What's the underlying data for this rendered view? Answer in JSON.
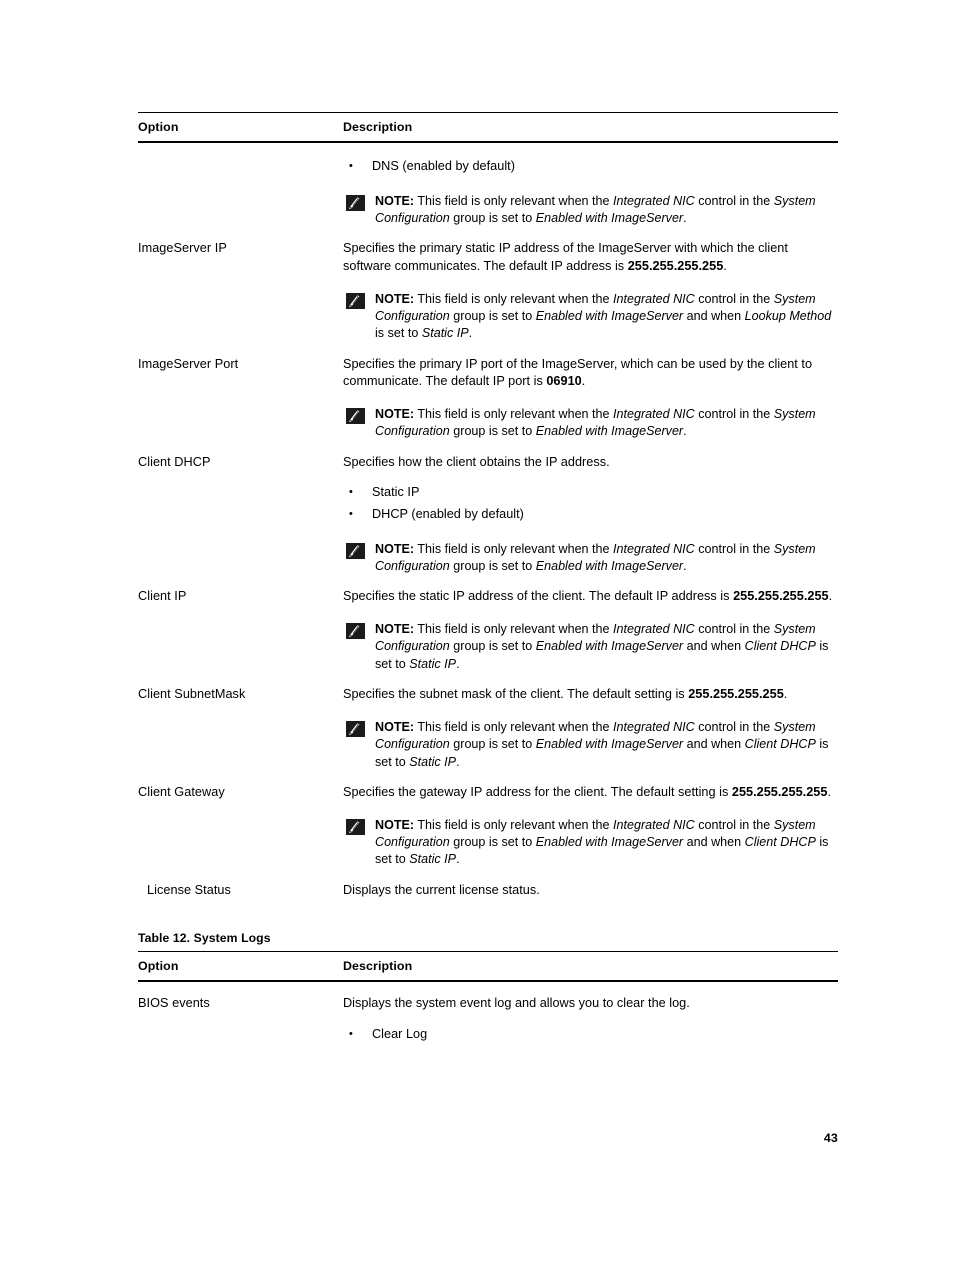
{
  "page": {
    "number": "43"
  },
  "tables": [
    {
      "caption": null,
      "headers": {
        "option": "Option",
        "description": "Description"
      },
      "rows": [
        {
          "option": "",
          "description_paragraph": null,
          "bullets": [
            "DNS (enabled by default)"
          ],
          "note": {
            "label": "NOTE:",
            "segments": [
              {
                "text": " This field is only relevant when the ",
                "style": "normal"
              },
              {
                "text": "Integrated NIC",
                "style": "italic"
              },
              {
                "text": " control in the ",
                "style": "normal"
              },
              {
                "text": "System Configuration",
                "style": "italic"
              },
              {
                "text": " group is set to ",
                "style": "normal"
              },
              {
                "text": "Enabled with ImageServer",
                "style": "italic"
              },
              {
                "text": ".",
                "style": "normal"
              }
            ]
          }
        },
        {
          "option": "ImageServer IP",
          "description_paragraph": [
            {
              "text": "Specifies the primary static IP address of the ImageServer with which the client software communicates. The default IP address is ",
              "style": "normal"
            },
            {
              "text": "255.255.255.255",
              "style": "bold"
            },
            {
              "text": ".",
              "style": "normal"
            }
          ],
          "bullets": [],
          "note": {
            "label": "NOTE:",
            "segments": [
              {
                "text": " This field is only relevant when the ",
                "style": "normal"
              },
              {
                "text": "Integrated NIC",
                "style": "italic"
              },
              {
                "text": " control in the ",
                "style": "normal"
              },
              {
                "text": "System Configuration",
                "style": "italic"
              },
              {
                "text": " group is set to ",
                "style": "normal"
              },
              {
                "text": "Enabled with ImageServer",
                "style": "italic"
              },
              {
                "text": " and when ",
                "style": "normal"
              },
              {
                "text": "Lookup Method",
                "style": "italic"
              },
              {
                "text": " is set to ",
                "style": "normal"
              },
              {
                "text": "Static IP",
                "style": "italic"
              },
              {
                "text": ".",
                "style": "normal"
              }
            ]
          }
        },
        {
          "option": "ImageServer Port",
          "description_paragraph": [
            {
              "text": "Specifies the primary IP port of the ImageServer, which can be used by the client to communicate. The default IP port is ",
              "style": "normal"
            },
            {
              "text": "06910",
              "style": "bold"
            },
            {
              "text": ".",
              "style": "normal"
            }
          ],
          "bullets": [],
          "note": {
            "label": "NOTE:",
            "segments": [
              {
                "text": " This field is only relevant when the ",
                "style": "normal"
              },
              {
                "text": "Integrated NIC",
                "style": "italic"
              },
              {
                "text": " control in the ",
                "style": "normal"
              },
              {
                "text": "System Configuration",
                "style": "italic"
              },
              {
                "text": " group is set to ",
                "style": "normal"
              },
              {
                "text": "Enabled with ImageServer",
                "style": "italic"
              },
              {
                "text": ".",
                "style": "normal"
              }
            ]
          }
        },
        {
          "option": "Client DHCP",
          "description_paragraph": [
            {
              "text": "Specifies how the client obtains the IP address.",
              "style": "normal"
            }
          ],
          "bullets": [
            "Static IP",
            "DHCP (enabled by default)"
          ],
          "note": {
            "label": "NOTE:",
            "segments": [
              {
                "text": " This field is only relevant when the ",
                "style": "normal"
              },
              {
                "text": "Integrated NIC",
                "style": "italic"
              },
              {
                "text": " control in the ",
                "style": "normal"
              },
              {
                "text": "System Configuration",
                "style": "italic"
              },
              {
                "text": " group is set to ",
                "style": "normal"
              },
              {
                "text": "Enabled with ImageServer",
                "style": "italic"
              },
              {
                "text": ".",
                "style": "normal"
              }
            ]
          }
        },
        {
          "option": "Client IP",
          "description_paragraph": [
            {
              "text": "Specifies the static IP address of the client. The default IP address is ",
              "style": "normal"
            },
            {
              "text": "255.255.255.255",
              "style": "bold"
            },
            {
              "text": ".",
              "style": "normal"
            }
          ],
          "bullets": [],
          "note": {
            "label": "NOTE:",
            "segments": [
              {
                "text": " This field is only relevant when the ",
                "style": "normal"
              },
              {
                "text": "Integrated NIC",
                "style": "italic"
              },
              {
                "text": " control in the ",
                "style": "normal"
              },
              {
                "text": "System Configuration",
                "style": "italic"
              },
              {
                "text": " group is set to ",
                "style": "normal"
              },
              {
                "text": "Enabled with ImageServer",
                "style": "italic"
              },
              {
                "text": " and when ",
                "style": "normal"
              },
              {
                "text": "Client DHCP",
                "style": "italic"
              },
              {
                "text": " is set to ",
                "style": "normal"
              },
              {
                "text": "Static IP",
                "style": "italic"
              },
              {
                "text": ".",
                "style": "normal"
              }
            ]
          }
        },
        {
          "option": "Client SubnetMask",
          "description_paragraph": [
            {
              "text": "Specifies the subnet mask of the client. The default setting is ",
              "style": "normal"
            },
            {
              "text": "255.255.255.255",
              "style": "bold"
            },
            {
              "text": ".",
              "style": "normal"
            }
          ],
          "bullets": [],
          "note": {
            "label": "NOTE:",
            "segments": [
              {
                "text": " This field is only relevant when the ",
                "style": "normal"
              },
              {
                "text": "Integrated NIC",
                "style": "italic"
              },
              {
                "text": " control in the ",
                "style": "normal"
              },
              {
                "text": "System Configuration",
                "style": "italic"
              },
              {
                "text": " group is set to ",
                "style": "normal"
              },
              {
                "text": "Enabled with ImageServer",
                "style": "italic"
              },
              {
                "text": " and when ",
                "style": "normal"
              },
              {
                "text": "Client DHCP",
                "style": "italic"
              },
              {
                "text": " is set to ",
                "style": "normal"
              },
              {
                "text": "Static IP",
                "style": "italic"
              },
              {
                "text": ".",
                "style": "normal"
              }
            ]
          }
        },
        {
          "option": "Client Gateway",
          "description_paragraph": [
            {
              "text": "Specifies the gateway IP address for the client. The default setting is ",
              "style": "normal"
            },
            {
              "text": "255.255.255.255",
              "style": "bold"
            },
            {
              "text": ".",
              "style": "normal"
            }
          ],
          "bullets": [],
          "note": {
            "label": "NOTE:",
            "segments": [
              {
                "text": " This field is only relevant when the ",
                "style": "normal"
              },
              {
                "text": "Integrated NIC",
                "style": "italic"
              },
              {
                "text": " control in the ",
                "style": "normal"
              },
              {
                "text": "System Configuration",
                "style": "italic"
              },
              {
                "text": " group is set to ",
                "style": "normal"
              },
              {
                "text": "Enabled with ImageServer",
                "style": "italic"
              },
              {
                "text": " and when ",
                "style": "normal"
              },
              {
                "text": "Client DHCP",
                "style": "italic"
              },
              {
                "text": " is set to ",
                "style": "normal"
              },
              {
                "text": "Static IP",
                "style": "italic"
              },
              {
                "text": ".",
                "style": "normal"
              }
            ]
          }
        },
        {
          "option": "License Status",
          "option_indent": true,
          "description_paragraph": [
            {
              "text": "Displays the current license status.",
              "style": "normal"
            }
          ],
          "bullets": [],
          "note": null
        }
      ]
    },
    {
      "caption": "Table 12. System Logs",
      "headers": {
        "option": "Option",
        "description": "Description"
      },
      "rows": [
        {
          "option": "BIOS events",
          "description_paragraph": [
            {
              "text": "Displays the system event log and allows you to clear the log.",
              "style": "normal"
            }
          ],
          "bullets": [
            "Clear Log"
          ],
          "note": null
        }
      ]
    }
  ],
  "icons": {
    "note": "note-pencil-icon"
  }
}
